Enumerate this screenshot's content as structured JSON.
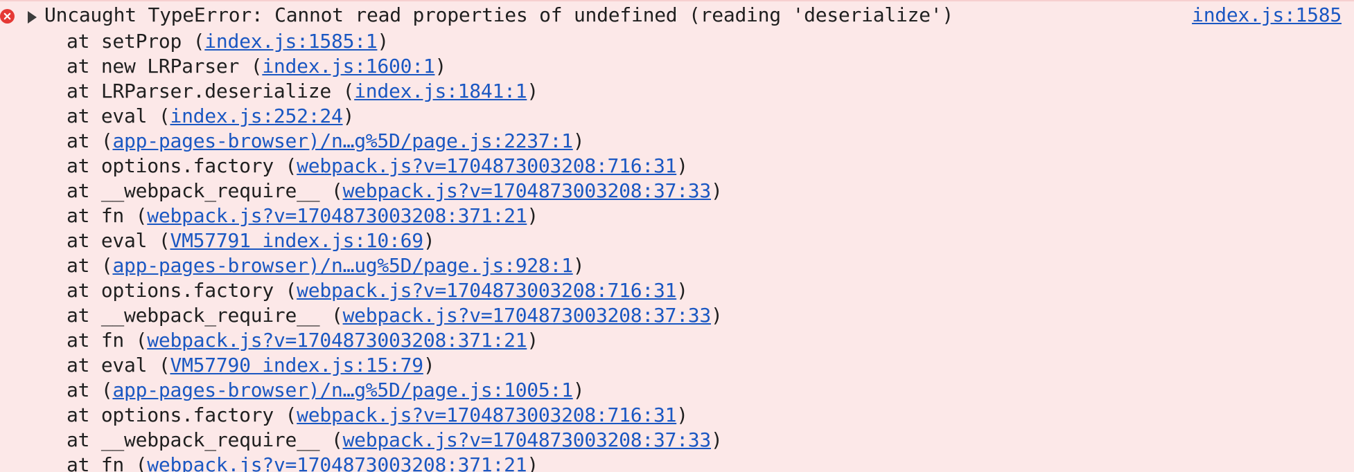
{
  "error": {
    "icon": "error-circle-x-icon",
    "toggle_icon": "expand-triangle-icon",
    "message": "Uncaught TypeError: Cannot read properties of undefined (reading 'deserialize')",
    "source_link": "index.js:1585",
    "colors": {
      "background": "#fce8e8",
      "icon": "#e53935",
      "link": "#1a57c2",
      "text": "#1f1f1f"
    }
  },
  "stack": [
    {
      "prefix": "at setProp (",
      "location": "index.js:1585:1",
      "suffix": ")"
    },
    {
      "prefix": "at new LRParser (",
      "location": "index.js:1600:1",
      "suffix": ")"
    },
    {
      "prefix": "at LRParser.deserialize (",
      "location": "index.js:1841:1",
      "suffix": ")"
    },
    {
      "prefix": "at eval (",
      "location": "index.js:252:24",
      "suffix": ")"
    },
    {
      "prefix": "at (",
      "location": "app-pages-browser)/n…g%5D/page.js:2237:1",
      "suffix": ")"
    },
    {
      "prefix": "at options.factory (",
      "location": "webpack.js?v=1704873003208:716:31",
      "suffix": ")"
    },
    {
      "prefix": "at __webpack_require__ (",
      "location": "webpack.js?v=1704873003208:37:33",
      "suffix": ")"
    },
    {
      "prefix": "at fn (",
      "location": "webpack.js?v=1704873003208:371:21",
      "suffix": ")"
    },
    {
      "prefix": "at eval (",
      "location": "VM57791 index.js:10:69",
      "suffix": ")"
    },
    {
      "prefix": "at (",
      "location": "app-pages-browser)/n…ug%5D/page.js:928:1",
      "suffix": ")"
    },
    {
      "prefix": "at options.factory (",
      "location": "webpack.js?v=1704873003208:716:31",
      "suffix": ")"
    },
    {
      "prefix": "at __webpack_require__ (",
      "location": "webpack.js?v=1704873003208:37:33",
      "suffix": ")"
    },
    {
      "prefix": "at fn (",
      "location": "webpack.js?v=1704873003208:371:21",
      "suffix": ")"
    },
    {
      "prefix": "at eval (",
      "location": "VM57790 index.js:15:79",
      "suffix": ")"
    },
    {
      "prefix": "at (",
      "location": "app-pages-browser)/n…g%5D/page.js:1005:1",
      "suffix": ")"
    },
    {
      "prefix": "at options.factory (",
      "location": "webpack.js?v=1704873003208:716:31",
      "suffix": ")"
    },
    {
      "prefix": "at __webpack_require__ (",
      "location": "webpack.js?v=1704873003208:37:33",
      "suffix": ")"
    },
    {
      "prefix": "at fn (",
      "location": "webpack.js?v=1704873003208:371:21",
      "suffix": ")"
    }
  ]
}
